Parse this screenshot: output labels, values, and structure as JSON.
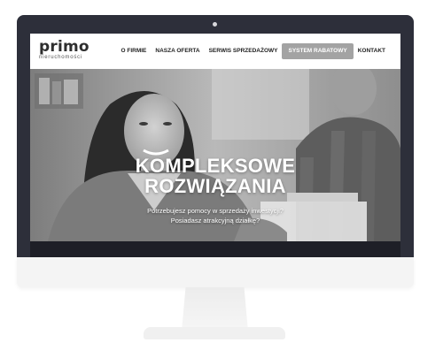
{
  "logo": {
    "name": "primo",
    "tagline": "nieruchomości"
  },
  "nav": {
    "items": [
      {
        "label": "O FIRMIE",
        "active": false
      },
      {
        "label": "NASZA OFERTA",
        "active": false
      },
      {
        "label": "SERWIS SPRZEDAŻOWY",
        "active": false
      },
      {
        "label": "SYSTEM RABATOWY",
        "active": true
      },
      {
        "label": "KONTAKT",
        "active": false
      }
    ]
  },
  "hero": {
    "title_line1": "KOMPLEKSOWE",
    "title_line2": "ROZWIĄZANIA",
    "sub_line1": "Potrzebujesz pomocy w sprzedaży inwestycji?",
    "sub_line2": "Posiadasz atrakcyjną działkę?"
  },
  "colors": {
    "bezel": "#2d2f3a",
    "active_nav_bg": "#a3a3a3",
    "hero_text": "#ffffff"
  }
}
